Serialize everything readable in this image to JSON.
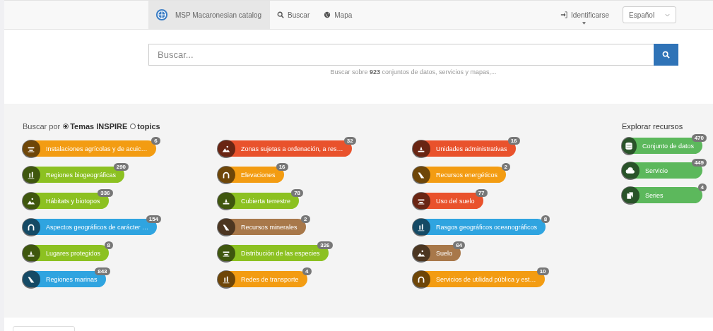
{
  "navbar": {
    "brand": "MSP Macaronesian catalog",
    "links": [
      {
        "label": "Buscar"
      },
      {
        "label": "Mapa"
      }
    ],
    "login": "Identificarse",
    "language": "Español"
  },
  "search": {
    "placeholder": "Buscar...",
    "hint_before": "Buscar sobre ",
    "count": "923",
    "hint_after": " conjuntos de datos, servicios y mapas,..."
  },
  "browse": {
    "label": "Buscar por",
    "options": [
      {
        "label": "Temas INSPIRE",
        "selected": true
      },
      {
        "label": "topics",
        "selected": false
      }
    ],
    "columns": [
      [
        {
          "label": "Instalaciones agrícolas y de acuic…",
          "count": "6",
          "color": "#f39c12"
        },
        {
          "label": "Regiones biogeográficas",
          "count": "290",
          "color": "#8cc121"
        },
        {
          "label": "Hábitats y biotopos",
          "count": "336",
          "color": "#8cc121"
        },
        {
          "label": "Aspectos geográficos de carácter …",
          "count": "154",
          "color": "#2fa4e0"
        },
        {
          "label": "Lugares protegidos",
          "count": "8",
          "color": "#8cc121"
        },
        {
          "label": "Regiones marinas",
          "count": "843",
          "color": "#2fa4e0"
        }
      ],
      [
        {
          "label": "Zonas sujetas a ordenación, a res…",
          "count": "32",
          "color": "#e9522c"
        },
        {
          "label": "Elevaciones",
          "count": "16",
          "color": "#f39c12"
        },
        {
          "label": "Cubierta terrestre",
          "count": "78",
          "color": "#8cc121"
        },
        {
          "label": "Recursos minerales",
          "count": "2",
          "color": "#a8784a"
        },
        {
          "label": "Distribución de las especies",
          "count": "326",
          "color": "#8cc121"
        },
        {
          "label": "Redes de transporte",
          "count": "4",
          "color": "#f39c12"
        }
      ],
      [
        {
          "label": "Unidades administrativas",
          "count": "16",
          "color": "#e9522c"
        },
        {
          "label": "Recursos energéticos",
          "count": "2",
          "color": "#f39c12"
        },
        {
          "label": "Uso del suelo",
          "count": "77",
          "color": "#e9522c"
        },
        {
          "label": "Rasgos geográficos oceanográficos",
          "count": "8",
          "color": "#2fa4e0"
        },
        {
          "label": "Suelo",
          "count": "64",
          "color": "#a8784a"
        },
        {
          "label": "Servicios de utilidad pública y est…",
          "count": "10",
          "color": "#f39c12"
        }
      ]
    ]
  },
  "explore": {
    "title": "Explorar recursos",
    "items": [
      {
        "label": "Conjunto de datos",
        "count": "470"
      },
      {
        "label": "Servicio",
        "count": "449"
      },
      {
        "label": "Series",
        "count": "4"
      }
    ]
  }
}
